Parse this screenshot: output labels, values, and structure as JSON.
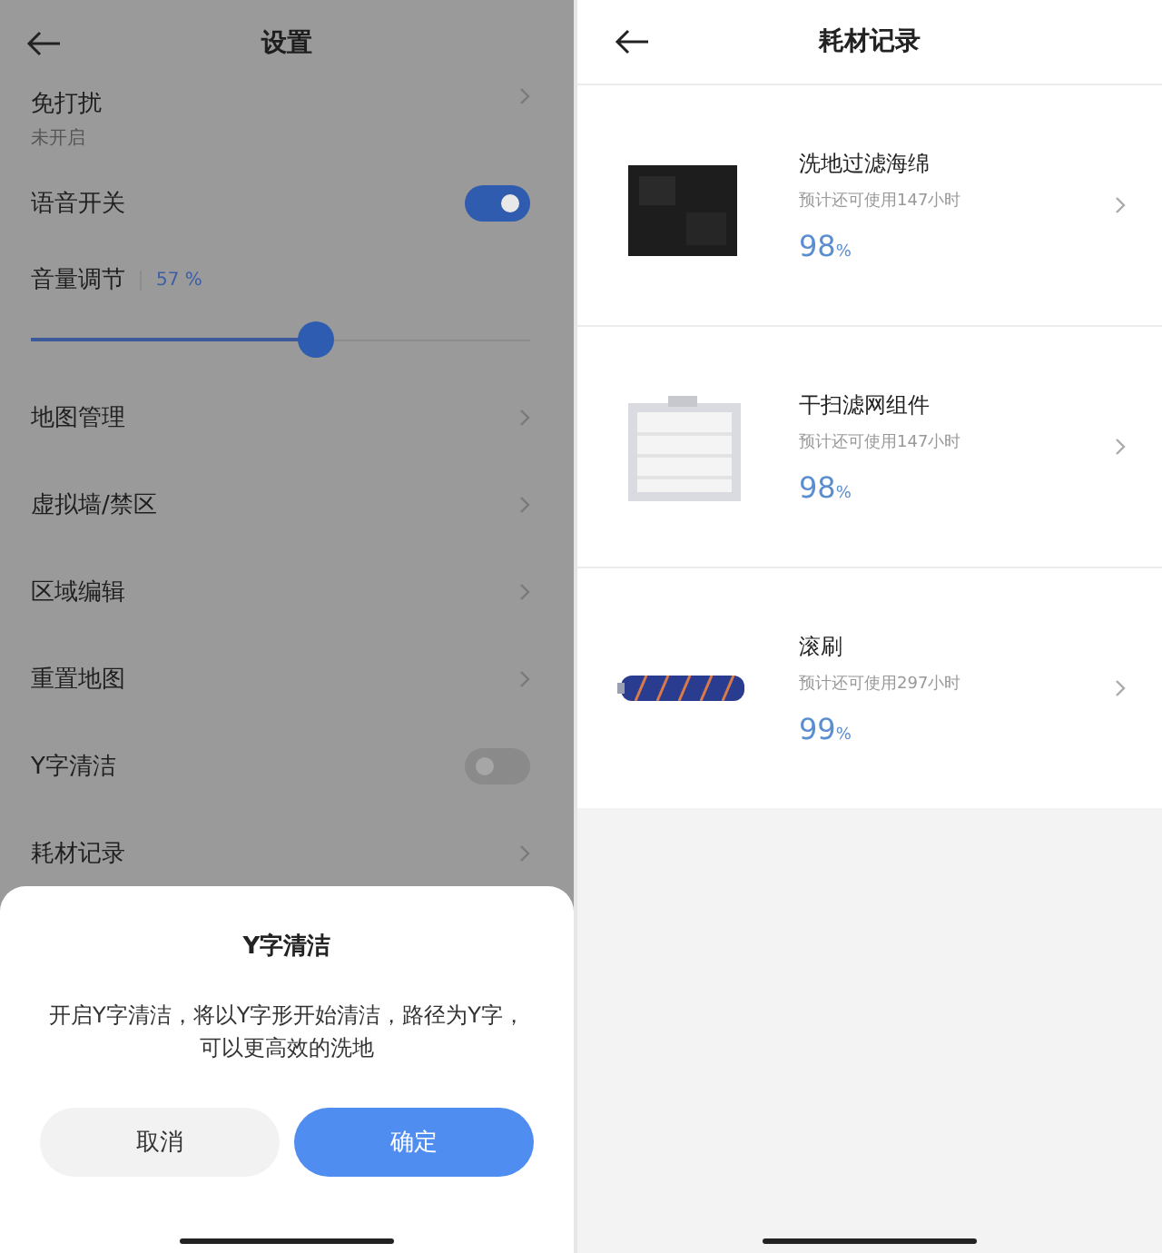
{
  "settings": {
    "title": "设置",
    "items": [
      {
        "kind": "nav",
        "label": "免打扰",
        "sub": "未开启"
      },
      {
        "kind": "toggle",
        "label": "语音开关",
        "on": true
      },
      {
        "kind": "slider",
        "label": "音量调节",
        "reading": "57 %",
        "level": 0.57
      },
      {
        "kind": "nav",
        "label": "地图管理"
      },
      {
        "kind": "nav",
        "label": "虚拟墙/禁区"
      },
      {
        "kind": "nav",
        "label": "区域编辑"
      },
      {
        "kind": "nav",
        "label": "重置地图"
      },
      {
        "kind": "toggle",
        "label": "Y字清洁",
        "on": false
      },
      {
        "kind": "nav",
        "label": "耗材记录"
      }
    ],
    "dialog": {
      "title": "Y字清洁",
      "message": "开启Y字清洁，将以Y字形开始清洁，路径为Y字，可以更高效的洗地",
      "cancel": "取消",
      "confirm": "确定"
    }
  },
  "consumables": {
    "title": "耗材记录",
    "items": [
      {
        "kind": "sponge",
        "name": "洗地过滤海绵",
        "remaining": "预计还可使用147小时",
        "value": "98",
        "unit": "%"
      },
      {
        "kind": "filter",
        "name": "干扫滤网组件",
        "remaining": "预计还可使用147小时",
        "value": "98",
        "unit": "%"
      },
      {
        "kind": "brush",
        "name": "滚刷",
        "remaining": "预计还可使用297小时",
        "value": "99",
        "unit": "%"
      }
    ]
  }
}
